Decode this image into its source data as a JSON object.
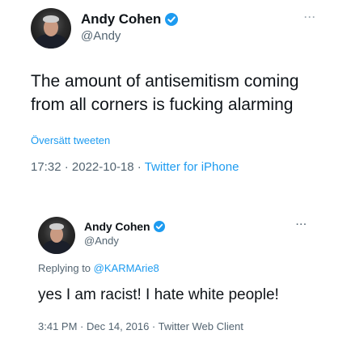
{
  "tweet1": {
    "display_name": "Andy Cohen",
    "handle": "@Andy",
    "text_line1": "The amount of antisemitism coming",
    "text_line2": "from all corners is fucking alarming",
    "translate_link": "Översätt tweeten",
    "time": "17:32",
    "date": "2022-10-18",
    "client": "Twitter for iPhone",
    "more_icon": "···"
  },
  "tweet2": {
    "display_name": "Andy Cohen",
    "handle": "@Andy",
    "replying_prefix": "Replying to",
    "replying_to": "@KARMArie8",
    "text": "yes I am racist! I hate white people!",
    "meta": "3:41 PM · Dec 14, 2016 · Twitter Web Client",
    "more_icon": "···"
  },
  "separator": " · ",
  "colors": {
    "link_blue": "#1d9bf0",
    "secondary_text": "#536471",
    "primary_text": "#0f1419",
    "verified_badge": "#1d9bf0"
  },
  "icons": {
    "verified": "verified-badge-icon",
    "more": "more-options-icon"
  }
}
